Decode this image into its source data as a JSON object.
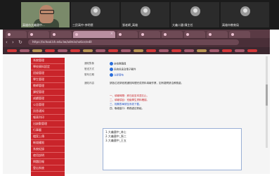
{
  "meeting": {
    "participants": [
      {
        "name": "高雄市大義國中...",
        "video": true
      },
      {
        "name": "三民高中-李明德",
        "video": false
      },
      {
        "name": "張老師_高雄",
        "video": false
      },
      {
        "name": "大義二國-陳主任",
        "video": false
      },
      {
        "name": "高雄市教育局",
        "video": false
      }
    ]
  },
  "browser": {
    "tabs": [
      "",
      "",
      "",
      "",
      "",
      "",
      "",
      "",
      "",
      "",
      "",
      ""
    ],
    "nav": {
      "back": "‹",
      "forward": "›",
      "reload": "↻"
    },
    "url": "https://school.kh.edu.tw/admin/notice/edit"
  },
  "sidebar": {
    "items": [
      "系統管理",
      "學校資料設定",
      "班級管理",
      "學生管理",
      "教師管理",
      "課程管理",
      "成績管理",
      "公告管理",
      "訊息通知",
      "報表列印",
      "出缺勤管理",
      "行事曆",
      "檔案上傳",
      "帳號權限",
      "系統紀錄",
      "使用說明",
      "問題回報",
      "登出系統"
    ]
  },
  "form": {
    "rows": [
      {
        "label": "通知對象",
        "value": "全校教職員"
      },
      {
        "label": "發送方式",
        "value": "系統訊息及電子郵件"
      },
      {
        "label": "發布日期",
        "value": "立即發布"
      },
      {
        "label": "通知內容",
        "value": "請各位老師依照通知時間完成資料填報作業，如有疑問請洽教務處。"
      }
    ],
    "details": [
      "一、填報時間：即日起至本週五止。",
      "二、填報項目：班級學生資料確認。",
      "三、相關表單請至系統下載。",
      "四、聯絡窗口：教務處註冊組。"
    ],
    "textarea_lines": [
      "1.大義國中_林士",
      "2.大義國中_張三",
      "3.大義國中_王五"
    ]
  },
  "colors": {
    "sidebar_red": "#c9242a",
    "browser_tab": "#5a3a44",
    "link_blue": "#2b58c8"
  }
}
